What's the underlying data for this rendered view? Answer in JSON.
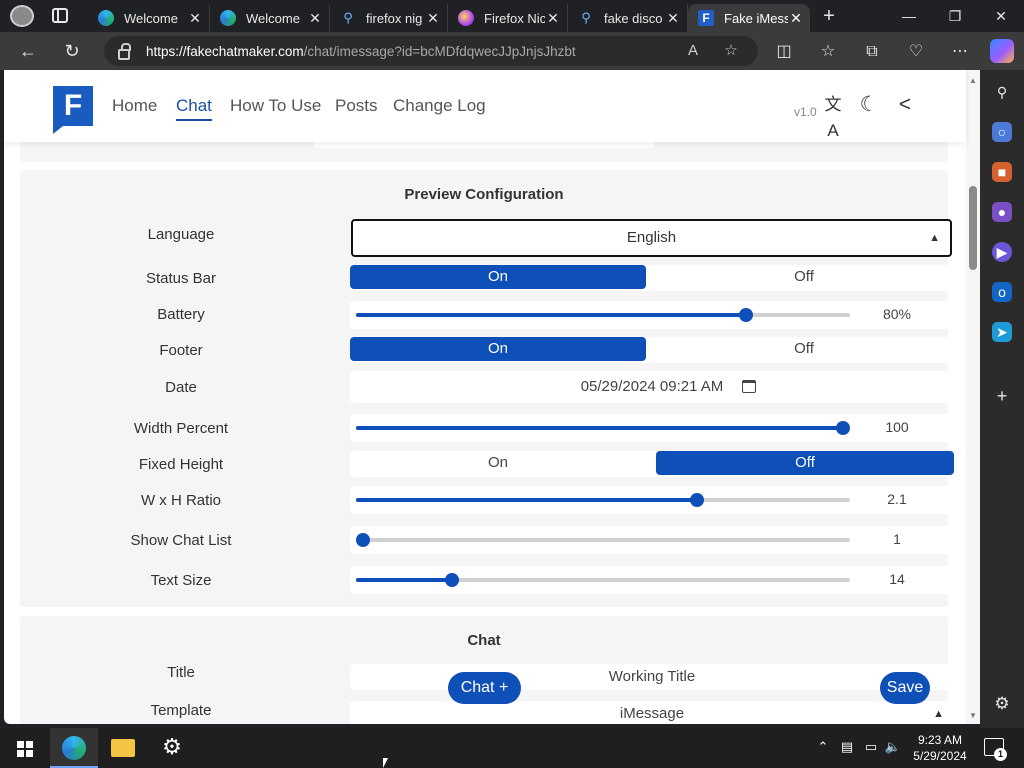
{
  "browser": {
    "tabs": [
      {
        "label": "Welcome",
        "icon": "edge-icon"
      },
      {
        "label": "Welcome",
        "icon": "edge-icon"
      },
      {
        "label": "firefox nig",
        "icon": "search-icon"
      },
      {
        "label": "Firefox Nic",
        "icon": "firefox-icon"
      },
      {
        "label": "fake disco",
        "icon": "search-icon"
      },
      {
        "label": "Fake iMess",
        "icon": "site-logo-icon",
        "active": true
      }
    ],
    "close_glyph": "✕",
    "new_tab_glyph": "+",
    "window_controls": {
      "minimize": "—",
      "maximize": "❐",
      "close": "✕"
    },
    "url_host": "https://fakechatmaker.com",
    "url_rest": "/chat/imessage?id=bcMDfdqwecJJpJnjsJhzbt",
    "url_icons": {
      "read_aloud": "A",
      "favorite": "☆"
    }
  },
  "site": {
    "logo_letter": "F",
    "nav": [
      "Home",
      "Chat",
      "How To Use",
      "Posts",
      "Change Log"
    ],
    "active_nav": "Chat",
    "version": "v1.0",
    "header_icons": {
      "translate": "文A",
      "dark_mode": "☾",
      "share": "<"
    }
  },
  "preview_config": {
    "title": "Preview Configuration",
    "rows": {
      "language": {
        "label": "Language",
        "value": "English"
      },
      "status_bar": {
        "label": "Status Bar",
        "on": "On",
        "off": "Off",
        "selected": "On"
      },
      "battery": {
        "label": "Battery",
        "value": "80%",
        "level": 0.79
      },
      "footer": {
        "label": "Footer",
        "on": "On",
        "off": "Off",
        "selected": "On"
      },
      "date": {
        "label": "Date",
        "value": "05/29/2024 09:21 AM"
      },
      "width_percent": {
        "label": "Width Percent",
        "value": "100",
        "level": 0.985
      },
      "fixed_height": {
        "label": "Fixed Height",
        "on": "On",
        "off": "Off",
        "selected": "Off"
      },
      "wh_ratio": {
        "label": "W x H Ratio",
        "value": "2.1",
        "level": 0.69
      },
      "show_chat_list": {
        "label": "Show Chat List",
        "value": "1",
        "level": 0.015
      },
      "text_size": {
        "label": "Text Size",
        "value": "14",
        "level": 0.195
      }
    }
  },
  "chat": {
    "title": "Chat",
    "rows": {
      "title": {
        "label": "Title",
        "value": "Working Title"
      },
      "template": {
        "label": "Template",
        "value": "iMessage"
      }
    },
    "chat_button": "Chat +",
    "save_button": "Save"
  },
  "taskbar": {
    "time": "9:23 AM",
    "date": "5/29/2024",
    "notifications": "1"
  },
  "colors": {
    "accent": "#0f4fb8",
    "nav_active": "#1a4ea6"
  }
}
